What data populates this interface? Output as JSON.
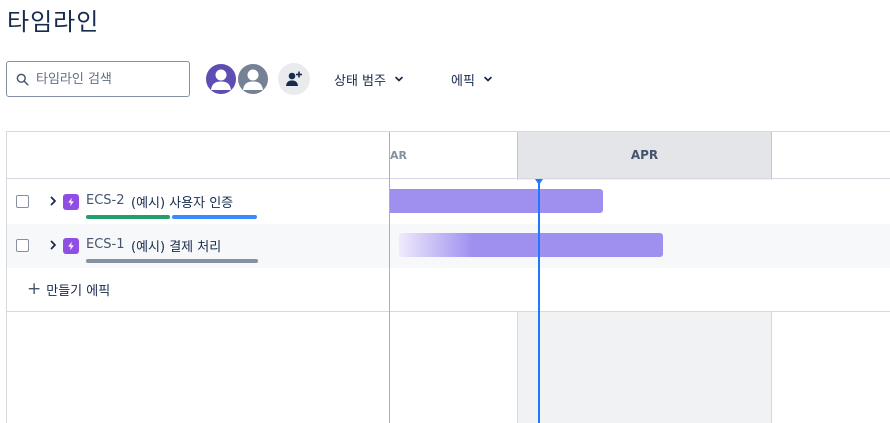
{
  "page": {
    "title": "타임라인"
  },
  "search": {
    "placeholder": "타임라인 검색"
  },
  "toolbar": {
    "avatars": [
      {
        "name": "user-avatar",
        "color": "#5e4db2"
      },
      {
        "name": "user-avatar",
        "color": "#758195"
      }
    ],
    "add_people_icon": "person-add-icon",
    "filters": [
      {
        "label": "상태 범주",
        "icon": "chevron-down-icon"
      },
      {
        "label": "에픽",
        "icon": "chevron-down-icon"
      }
    ]
  },
  "timeline": {
    "months": [
      {
        "label": "AR"
      },
      {
        "label": "APR"
      }
    ],
    "rows": [
      {
        "key": "ECS-2",
        "title": "(예시) 사용자 인증",
        "progress_colors": [
          "#22a06b",
          "#388bff"
        ],
        "progress": {
          "done": 0.5,
          "in_progress": 0.5
        },
        "bar_color": "#9f8fef"
      },
      {
        "key": "ECS-1",
        "title": "(예시) 결제 처리",
        "progress_colors": [
          "#8590a2"
        ],
        "progress": {
          "todo": 1.0
        },
        "bar_color": "#9f8fef"
      }
    ],
    "create_label": "만들기 에픽",
    "today_color": "#1d7afc"
  }
}
